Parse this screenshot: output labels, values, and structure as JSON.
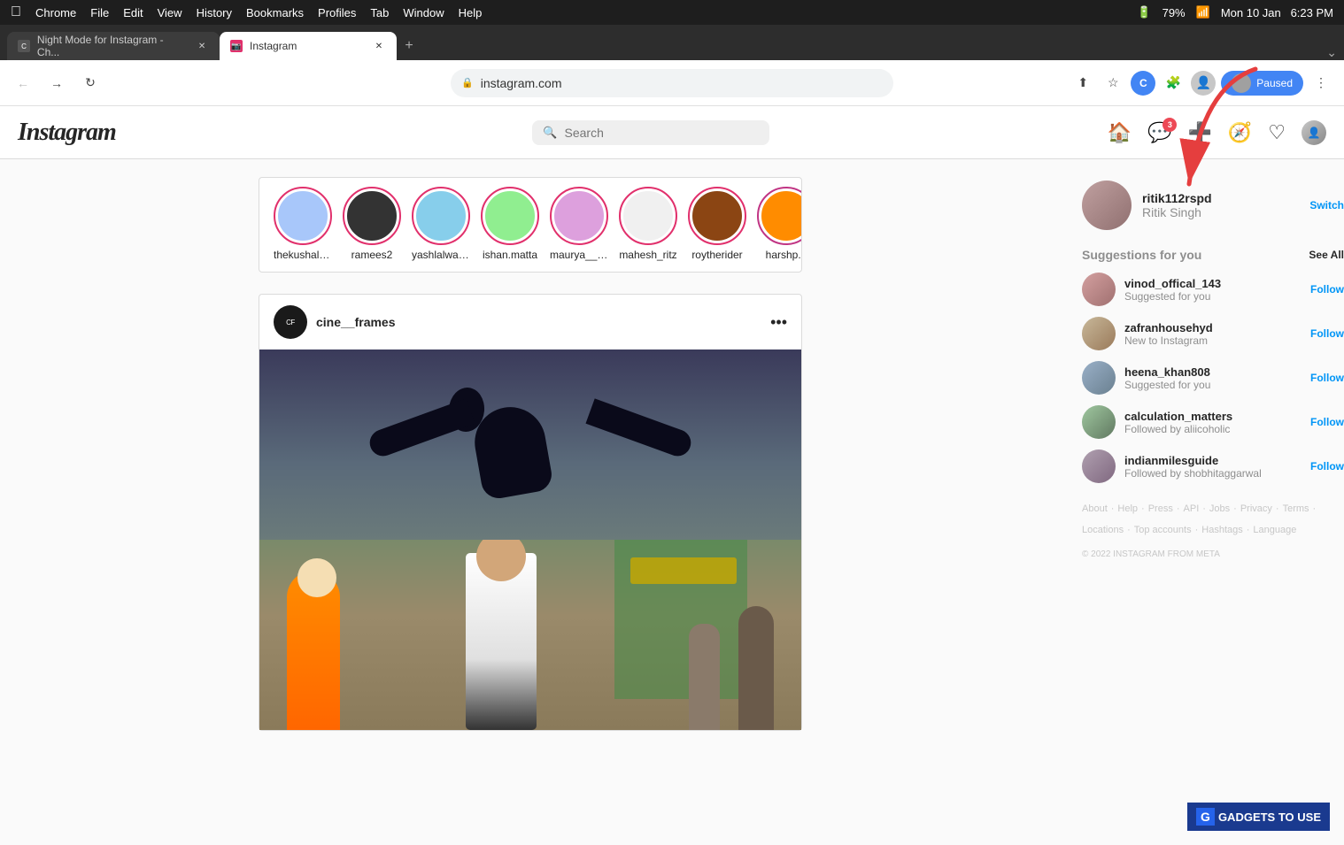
{
  "mac_bar": {
    "apple": "⌘",
    "left_items": [
      "Chrome",
      "File",
      "Edit",
      "View",
      "History",
      "Bookmarks",
      "Profiles",
      "Tab",
      "Window",
      "Help"
    ],
    "right_items": [
      "79%",
      "Mon 10 Jan",
      "6:23 PM"
    ]
  },
  "browser": {
    "tabs": [
      {
        "id": "tab1",
        "title": "Night Mode for Instagram - Ch...",
        "active": false,
        "favicon_color": "#888"
      },
      {
        "id": "tab2",
        "title": "Instagram",
        "active": true,
        "favicon_color": "#e1306c"
      }
    ],
    "address": "instagram.com",
    "paused_label": "Paused"
  },
  "instagram": {
    "logo": "Instagram",
    "search_placeholder": "Search",
    "nav": {
      "home_icon": "🏠",
      "messages_icon": "💬",
      "messages_badge": "3",
      "new_post_icon": "➕",
      "explore_icon": "🧭",
      "heart_icon": "♡",
      "profile_icon": "👤"
    },
    "stories": [
      {
        "username": "thekushala...",
        "color": "story-color-1",
        "has_story": true
      },
      {
        "username": "ramees2",
        "color": "story-color-2",
        "has_story": true
      },
      {
        "username": "yashlalwan...",
        "color": "story-color-3",
        "has_story": true
      },
      {
        "username": "ishan.matta",
        "color": "story-color-4",
        "has_story": true
      },
      {
        "username": "maurya__me",
        "color": "story-color-5",
        "has_story": true
      },
      {
        "username": "mahesh_ritz",
        "color": "story-color-6",
        "has_story": true
      },
      {
        "username": "roytherider",
        "color": "story-color-7",
        "has_story": true
      },
      {
        "username": "harshp...",
        "color": "story-color-8",
        "has_story": true
      }
    ],
    "post": {
      "username": "cine__frames",
      "more_icon": "•••"
    },
    "sidebar": {
      "username": "ritik112rspd",
      "name": "Ritik Singh",
      "switch_label": "Switch",
      "suggestions_title": "Suggestions for you",
      "see_all_label": "See All",
      "suggestions": [
        {
          "username": "vinod_offical_143",
          "reason": "Suggested for you",
          "avatar_class": "sug-av-1"
        },
        {
          "username": "zafranhousehyd",
          "reason": "New to Instagram",
          "avatar_class": "sug-av-2"
        },
        {
          "username": "heena_khan808",
          "reason": "Suggested for you",
          "avatar_class": "sug-av-3"
        },
        {
          "username": "calculation_matters",
          "reason": "Followed by aliicoholic",
          "avatar_class": "sug-av-4"
        },
        {
          "username": "indianmilesguide",
          "reason": "Followed by shobhitaggarwal",
          "avatar_class": "sug-av-5"
        }
      ],
      "follow_label": "Follow",
      "footer_links": [
        "About",
        "Help",
        "Press",
        "API",
        "Jobs",
        "Privacy",
        "Terms",
        "Locations",
        "Top accounts",
        "Hashtags",
        "Language"
      ],
      "copyright": "© 2022 INSTAGRAM FROM META"
    }
  },
  "watermark": {
    "label": "GADGETS TO USE"
  }
}
